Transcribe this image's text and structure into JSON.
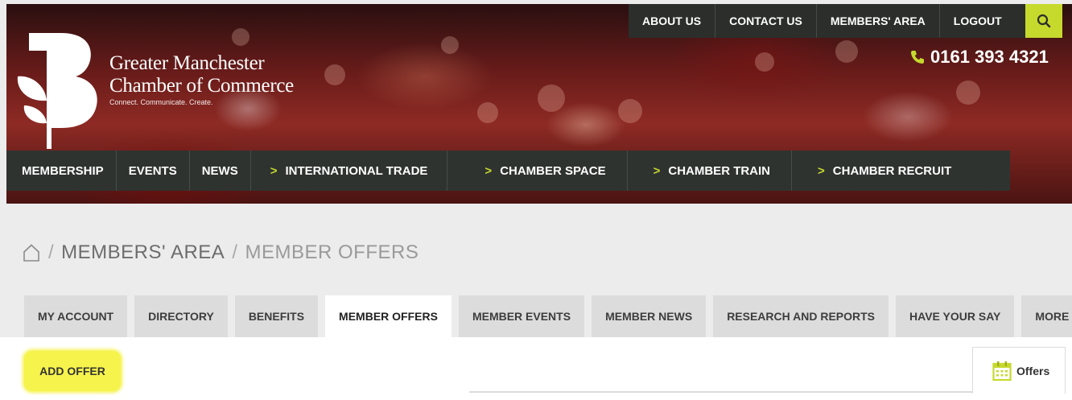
{
  "header": {
    "logo_lines": [
      "Greater Manchester",
      "Chamber of Commerce"
    ],
    "tagline": "Connect. Communicate. Create.",
    "phone": "0161 393 4321",
    "top_nav": [
      "ABOUT US",
      "CONTACT US",
      "MEMBERS' AREA",
      "LOGOUT"
    ],
    "main_nav": [
      {
        "label": "MEMBERSHIP",
        "chevron": false
      },
      {
        "label": "EVENTS",
        "chevron": false
      },
      {
        "label": "NEWS",
        "chevron": false
      },
      {
        "label": "INTERNATIONAL TRADE",
        "chevron": true
      },
      {
        "label": "CHAMBER SPACE",
        "chevron": true
      },
      {
        "label": "CHAMBER TRAIN",
        "chevron": true
      },
      {
        "label": "CHAMBER RECRUIT",
        "chevron": true
      }
    ],
    "chevron_glyph": ">",
    "accent_color": "#c6d92d"
  },
  "breadcrumb": {
    "home_icon": "home-icon",
    "separator": "/",
    "items": [
      "MEMBERS' AREA",
      "MEMBER OFFERS"
    ]
  },
  "tabs": {
    "items": [
      "MY ACCOUNT",
      "DIRECTORY",
      "BENEFITS",
      "MEMBER OFFERS",
      "MEMBER EVENTS",
      "MEMBER NEWS",
      "RESEARCH AND REPORTS",
      "HAVE YOUR SAY",
      "MORE"
    ],
    "active": "MEMBER OFFERS"
  },
  "content": {
    "add_offer_label": "ADD OFFER",
    "offers_tab_label": "Offers",
    "offers_icon": "calendar-icon",
    "highlight_color": "#f6f34c"
  }
}
